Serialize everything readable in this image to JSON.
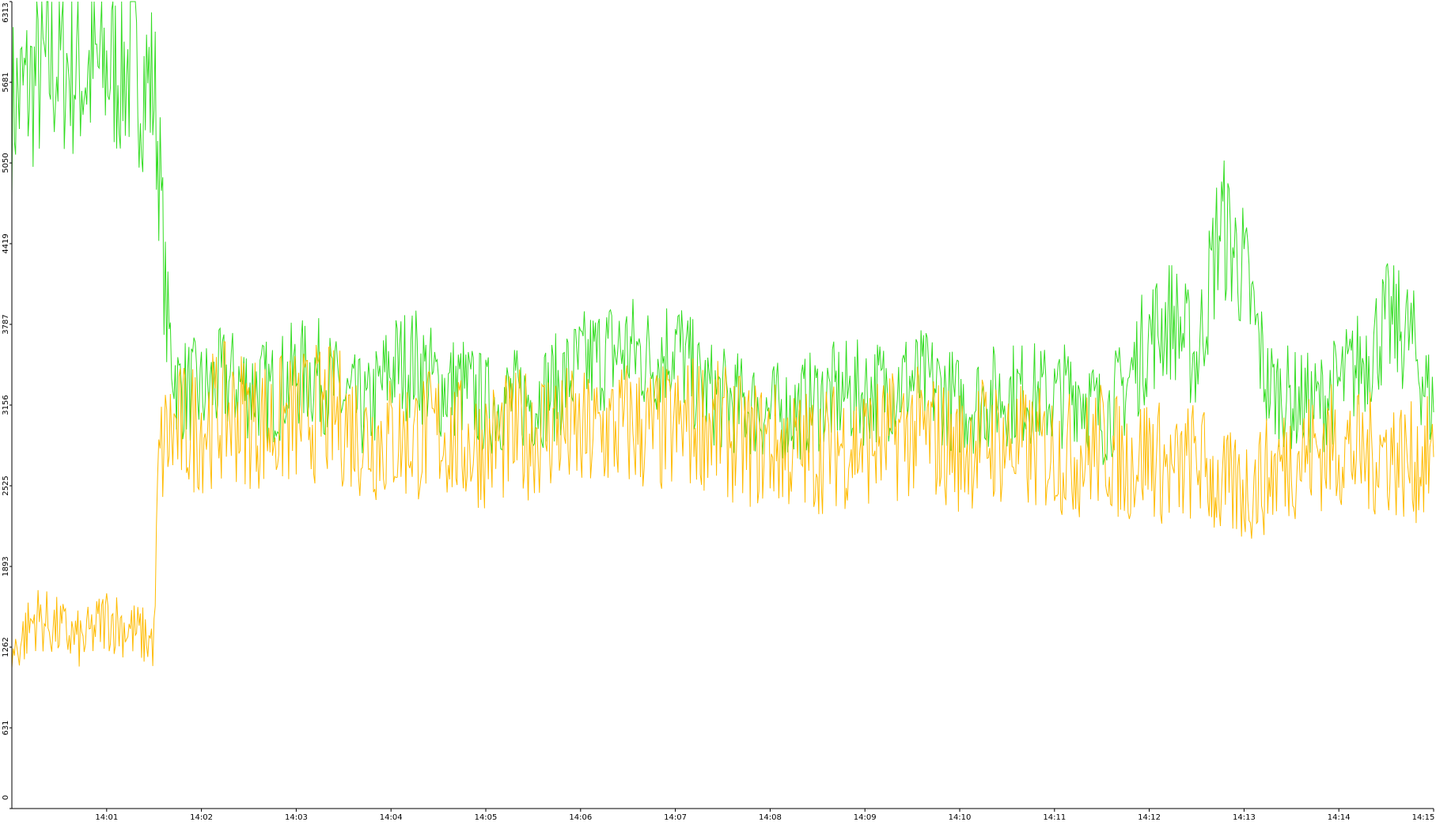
{
  "chart_data": {
    "type": "line",
    "title": "",
    "xlabel": "",
    "ylabel": "",
    "grid": false,
    "legend": "none",
    "xlim": [
      "14:00:00",
      "14:15:00"
    ],
    "ylim": [
      0,
      6313
    ],
    "y_ticks": [
      "0",
      "631",
      "1262",
      "1893",
      "2525",
      "3156",
      "3787",
      "4419",
      "5050",
      "5681",
      "6313"
    ],
    "x_ticks": [
      "14:01",
      "14:02",
      "14:03",
      "14:04",
      "14:05",
      "14:06",
      "14:07",
      "14:08",
      "14:09",
      "14:10",
      "14:11",
      "14:12",
      "14:13",
      "14:14",
      "14:15"
    ],
    "x_tick_values": [
      "14:01:00",
      "14:02:00",
      "14:03:00",
      "14:04:00",
      "14:05:00",
      "14:06:00",
      "14:07:00",
      "14:08:00",
      "14:09:00",
      "14:10:00",
      "14:11:00",
      "14:12:00",
      "14:13:00",
      "14:14:00",
      "14:15:00"
    ],
    "series": [
      {
        "color": "#33dd22",
        "x": [
          "14:00:00",
          "14:00:15",
          "14:00:30",
          "14:00:45",
          "14:01:00",
          "14:01:15",
          "14:01:30",
          "14:01:33",
          "14:01:38",
          "14:01:45",
          "14:02:00",
          "14:02:15",
          "14:02:30",
          "14:02:45",
          "14:03:00",
          "14:03:15",
          "14:03:30",
          "14:03:45",
          "14:04:00",
          "14:04:15",
          "14:04:30",
          "14:04:45",
          "14:05:00",
          "14:05:15",
          "14:05:30",
          "14:05:45",
          "14:06:00",
          "14:06:15",
          "14:06:30",
          "14:06:45",
          "14:07:00",
          "14:07:15",
          "14:07:30",
          "14:07:45",
          "14:08:00",
          "14:08:15",
          "14:08:30",
          "14:08:45",
          "14:09:00",
          "14:09:15",
          "14:09:30",
          "14:09:45",
          "14:10:00",
          "14:10:15",
          "14:10:30",
          "14:10:45",
          "14:11:00",
          "14:11:15",
          "14:11:30",
          "14:11:45",
          "14:12:00",
          "14:12:15",
          "14:12:30",
          "14:12:45",
          "14:13:00",
          "14:13:15",
          "14:13:30",
          "14:13:45",
          "14:14:00",
          "14:14:15",
          "14:14:30",
          "14:14:45",
          "14:15:00"
        ],
        "y": [
          5500,
          5700,
          5850,
          5750,
          5800,
          5800,
          5650,
          5100,
          3800,
          3300,
          3250,
          3350,
          3300,
          3250,
          3400,
          3400,
          3200,
          3100,
          3450,
          3500,
          3300,
          3300,
          3150,
          3200,
          3200,
          3300,
          3450,
          3550,
          3600,
          3500,
          3650,
          3300,
          3200,
          3150,
          3100,
          3100,
          3200,
          3250,
          3250,
          3300,
          3350,
          3300,
          3150,
          3200,
          3250,
          3250,
          3200,
          3300,
          3050,
          3300,
          3700,
          3850,
          3500,
          4600,
          4200,
          3300,
          3200,
          3150,
          3300,
          3500,
          3800,
          3700,
          3100
        ]
      },
      {
        "color": "#ffbb00",
        "x": [
          "14:00:00",
          "14:00:15",
          "14:00:30",
          "14:00:45",
          "14:01:00",
          "14:01:15",
          "14:01:30",
          "14:01:33",
          "14:01:38",
          "14:01:45",
          "14:02:00",
          "14:02:15",
          "14:02:30",
          "14:02:45",
          "14:03:00",
          "14:03:15",
          "14:03:30",
          "14:03:45",
          "14:04:00",
          "14:04:15",
          "14:04:30",
          "14:04:45",
          "14:05:00",
          "14:05:15",
          "14:05:30",
          "14:05:45",
          "14:06:00",
          "14:06:15",
          "14:06:30",
          "14:06:45",
          "14:07:00",
          "14:07:15",
          "14:07:30",
          "14:07:45",
          "14:08:00",
          "14:08:15",
          "14:08:30",
          "14:08:45",
          "14:09:00",
          "14:09:15",
          "14:09:30",
          "14:09:45",
          "14:10:00",
          "14:10:15",
          "14:10:30",
          "14:10:45",
          "14:11:00",
          "14:11:15",
          "14:11:30",
          "14:11:45",
          "14:12:00",
          "14:12:15",
          "14:12:30",
          "14:12:45",
          "14:13:00",
          "14:13:15",
          "14:13:30",
          "14:13:45",
          "14:14:00",
          "14:14:15",
          "14:14:30",
          "14:14:45",
          "14:15:00"
        ],
        "y": [
          1200,
          1500,
          1400,
          1300,
          1500,
          1400,
          1300,
          2700,
          2900,
          2950,
          3000,
          3100,
          3050,
          3000,
          3050,
          3100,
          3050,
          2900,
          2900,
          2900,
          2950,
          2850,
          2850,
          2900,
          2950,
          3000,
          2900,
          2950,
          3000,
          2950,
          2950,
          3050,
          2950,
          2850,
          2850,
          2800,
          2800,
          2850,
          2850,
          2900,
          2950,
          2900,
          2800,
          2900,
          2850,
          2800,
          2800,
          2750,
          2850,
          2700,
          2800,
          2600,
          2750,
          2500,
          2500,
          2600,
          2750,
          2800,
          2850,
          2750,
          2800,
          2700,
          2750
        ]
      }
    ]
  }
}
